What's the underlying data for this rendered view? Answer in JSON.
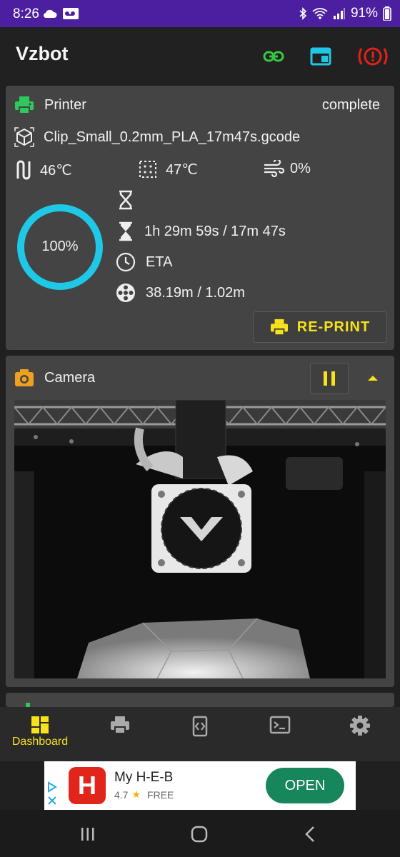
{
  "status_bar": {
    "time": "8:26",
    "battery": "91%"
  },
  "app": {
    "title": "Vzbot"
  },
  "printer": {
    "title": "Printer",
    "state": "complete",
    "filename": "Clip_Small_0.2mm_PLA_17m47s.gcode",
    "extruder_temp": "46℃",
    "bed_temp": "47℃",
    "fan": "0%",
    "progress_text": "100%",
    "progress_fraction": 1.0,
    "elapsed": "",
    "print_time": "1h 29m 59s / 17m 47s",
    "eta": "ETA",
    "filament": "38.19m / 1.02m",
    "reprint_label": "RE-PRINT"
  },
  "camera": {
    "title": "Camera"
  },
  "nav": {
    "dashboard_label": "Dashboard"
  },
  "ad": {
    "name": "My H-E-B",
    "rating": "4.7",
    "price": "FREE",
    "open_label": "OPEN"
  },
  "colors": {
    "accent_yellow": "#f7e21c",
    "link_green": "#35c940",
    "cyan": "#1ec8e6",
    "emergency_red": "#e0221c",
    "printer_green": "#2ec95a",
    "camera_orange": "#f0a020"
  }
}
